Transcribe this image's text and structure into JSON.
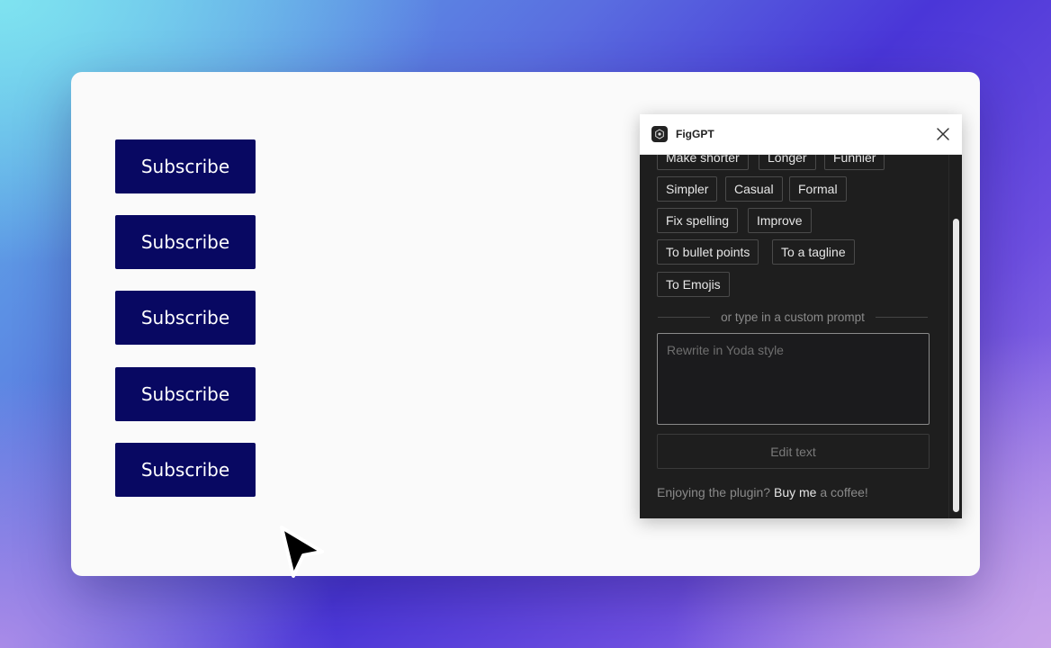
{
  "canvas": {
    "subscribe_buttons": [
      {
        "label": "Subscribe"
      },
      {
        "label": "Subscribe"
      },
      {
        "label": "Subscribe"
      },
      {
        "label": "Subscribe"
      },
      {
        "label": "Subscribe"
      }
    ]
  },
  "plugin": {
    "title": "FigGPT",
    "chips": [
      {
        "label": "Make shorter"
      },
      {
        "label": "Longer"
      },
      {
        "label": "Funnier"
      },
      {
        "label": "Simpler"
      },
      {
        "label": "Casual"
      },
      {
        "label": "Formal"
      },
      {
        "label": "Fix spelling"
      },
      {
        "label": "Improve"
      },
      {
        "label": "To bullet points"
      },
      {
        "label": "To a tagline"
      },
      {
        "label": "To Emojis"
      }
    ],
    "divider_text": "or type in a custom prompt",
    "prompt_placeholder": "Rewrite in Yoda style",
    "edit_button": "Edit text",
    "footer": {
      "prefix": "Enjoying the plugin?",
      "link": "Buy me",
      "suffix": "a coffee!"
    }
  },
  "colors": {
    "button_bg": "#080862",
    "plugin_bg": "#1e1e1e"
  }
}
